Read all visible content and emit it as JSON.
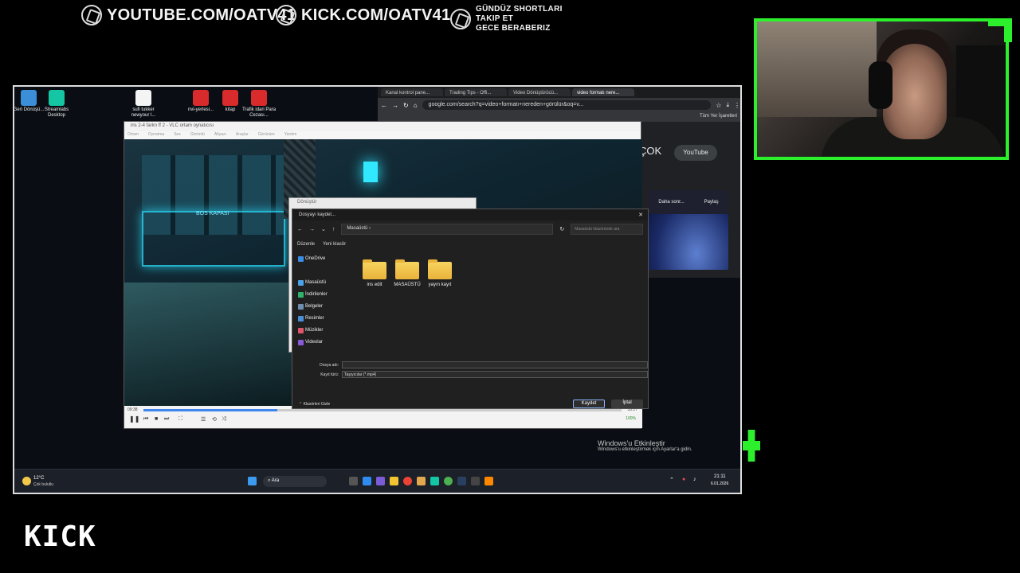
{
  "overlay": {
    "promo": {
      "youtube": "YOUTUBE.COM/OATV41",
      "kick": "KICK.COM/OATV41",
      "line1": "GÜNDÜZ SHORTLARI",
      "line2": "TAKIP ET",
      "line3": "GECE BERABERIZ"
    },
    "kick_logo": "KICK",
    "accent": "#2bf02b"
  },
  "desktop": {
    "icons": [
      {
        "label": "Geri Dönüşü...",
        "color": "#3b8fd8"
      },
      {
        "label": "Streamlabs Desktop",
        "color": "#14c6a4"
      },
      {
        "label": "sufi tukker newyour l...",
        "color": "#f4f4f4"
      },
      {
        "label": "nvi-yerlesi...",
        "color": "#d92b2b"
      },
      {
        "label": "kitap",
        "color": "#d92b2b"
      },
      {
        "label": "Trafik idari Para Cezası...",
        "color": "#d92b2b"
      }
    ],
    "watermark": {
      "title": "Windows'u Etkinleştir",
      "subtitle": "Windows'u etkinleştirmek için Ayarlar'a gidin."
    }
  },
  "chrome": {
    "tabs": [
      "Kanal kontrol pane...",
      "Trading Tips - Offi...",
      "Video Dönüştürücü...",
      "video formatı nere..."
    ],
    "url": "google.com/search?q=video+formatı+nereden+görülür&oq=v...",
    "bookmarks": "Tüm Yer İşaretleri",
    "result_text": "ÇOK",
    "youtube_btn": "YouTube",
    "video_actions": [
      "Daha sonr...",
      "Paylaş"
    ]
  },
  "vlc": {
    "title": "ins 2-4 farkn ff 2 - VLC ortam oynatıcısı",
    "menu": [
      "Ortam",
      "Oynatma",
      "Ses",
      "Görüntü",
      "Altyazı",
      "Araçlar",
      "Görünüm",
      "Yardım"
    ],
    "time_elapsed": "09:38",
    "time_total": "35:17",
    "progress": 0.28,
    "volume": "100%",
    "scene_text": "BOS KAPASI"
  },
  "convert_dialog": {
    "title": "Dönüştür"
  },
  "save_dialog": {
    "title": "Dosyayı kaydet...",
    "path": "Masaüstü",
    "search_placeholder": "Masaüstü klasöründe ara",
    "toolbar": {
      "organize": "Düzenle",
      "new_folder": "Yeni klasör"
    },
    "sidebar": [
      "OneDrive",
      "Masaüstü",
      "İndirilenler",
      "Belgeler",
      "Resimler",
      "Müzikler",
      "Videolar"
    ],
    "folders": [
      "ins edit",
      "MASAÜSTÜ",
      "yayın kayıt"
    ],
    "filename_label": "Dosya adı:",
    "filename_value": "",
    "type_label": "Kayıt türü:",
    "type_value": "Taşıyıcılar (*.mp4)",
    "hide_folders": "Klasörleri Gizle",
    "save_btn": "Kaydet",
    "cancel_btn": "İptal"
  },
  "taskbar": {
    "weather_temp": "12°C",
    "weather_desc": "Çok bulutlu",
    "search": "Ara",
    "time": "21:11",
    "date": "6.01.2026"
  }
}
